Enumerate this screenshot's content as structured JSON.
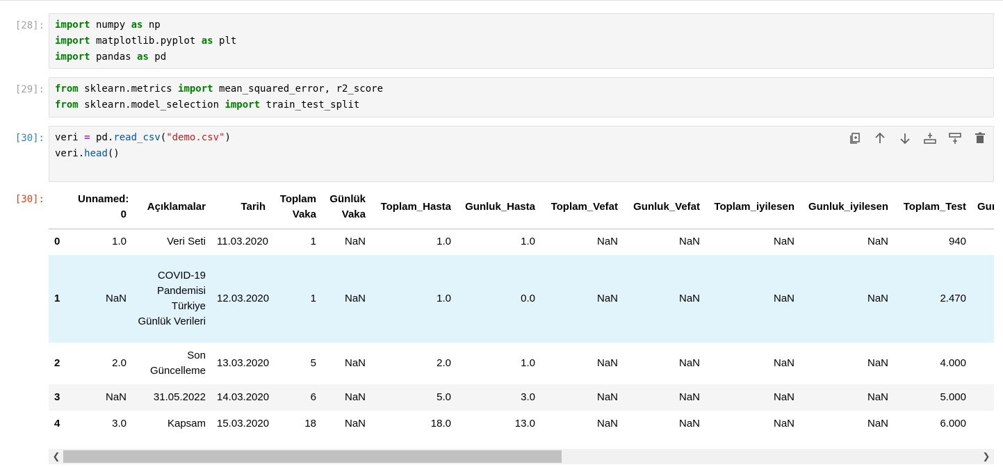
{
  "cells": [
    {
      "prompt": "[28]:",
      "lines": [
        [
          {
            "t": "import",
            "c": "kw"
          },
          {
            "t": " numpy ",
            "c": ""
          },
          {
            "t": "as",
            "c": "kw"
          },
          {
            "t": " np",
            "c": ""
          }
        ],
        [
          {
            "t": "import",
            "c": "kw"
          },
          {
            "t": " matplotlib.pyplot ",
            "c": ""
          },
          {
            "t": "as",
            "c": "kw"
          },
          {
            "t": " plt",
            "c": ""
          }
        ],
        [
          {
            "t": "import",
            "c": "kw"
          },
          {
            "t": " pandas ",
            "c": ""
          },
          {
            "t": "as",
            "c": "kw"
          },
          {
            "t": " pd",
            "c": ""
          }
        ]
      ]
    },
    {
      "prompt": "[29]:",
      "lines": [
        [
          {
            "t": "from",
            "c": "kw"
          },
          {
            "t": " sklearn.metrics ",
            "c": ""
          },
          {
            "t": "import",
            "c": "kw"
          },
          {
            "t": " mean_squared_error, r2_score",
            "c": ""
          }
        ],
        [
          {
            "t": "from",
            "c": "kw"
          },
          {
            "t": " sklearn.model_selection ",
            "c": ""
          },
          {
            "t": "import",
            "c": "kw"
          },
          {
            "t": " train_test_split",
            "c": ""
          }
        ]
      ]
    },
    {
      "prompt": "[30]:",
      "lines": [
        [
          {
            "t": "veri ",
            "c": ""
          },
          {
            "t": "=",
            "c": "op"
          },
          {
            "t": " pd.",
            "c": ""
          },
          {
            "t": "read_csv",
            "c": "fn"
          },
          {
            "t": "(",
            "c": ""
          },
          {
            "t": "\"demo.csv\"",
            "c": "str"
          },
          {
            "t": ")",
            "c": ""
          }
        ],
        [
          {
            "t": "veri.",
            "c": ""
          },
          {
            "t": "head",
            "c": "fn"
          },
          {
            "t": "()",
            "c": ""
          }
        ]
      ]
    }
  ],
  "toolbar": {
    "icons": [
      "duplicate-cell-icon",
      "move-up-icon",
      "move-down-icon",
      "insert-above-icon",
      "insert-below-icon",
      "delete-cell-icon"
    ]
  },
  "output": {
    "prompt": "[30]:",
    "columns": [
      "",
      "Unnamed: 0",
      "Açıklamalar",
      "Tarih",
      "Toplam Vaka",
      "Günlük Vaka",
      "Toplam_Hasta",
      "Gunluk_Hasta",
      "Toplam_Vefat",
      "Gunluk_Vefat",
      "Toplam_iyilesen",
      "Gunluk_iyilesen",
      "Toplam_Test",
      "Gunluk_Test"
    ],
    "rows": [
      [
        "0",
        "1.0",
        "Veri Seti",
        "11.03.2020",
        "1",
        "NaN",
        "1.0",
        "1.0",
        "NaN",
        "NaN",
        "NaN",
        "NaN",
        "940",
        ""
      ],
      [
        "1",
        "NaN",
        "COVID-19 Pandemisi Türkiye Günlük Verileri",
        "12.03.2020",
        "1",
        "NaN",
        "1.0",
        "0.0",
        "NaN",
        "NaN",
        "NaN",
        "NaN",
        "2.470",
        ""
      ],
      [
        "2",
        "2.0",
        "Son Güncelleme",
        "13.03.2020",
        "5",
        "NaN",
        "2.0",
        "1.0",
        "NaN",
        "NaN",
        "NaN",
        "NaN",
        "4.000",
        ""
      ],
      [
        "3",
        "NaN",
        "31.05.2022",
        "14.03.2020",
        "6",
        "NaN",
        "5.0",
        "3.0",
        "NaN",
        "NaN",
        "NaN",
        "NaN",
        "5.000",
        ""
      ],
      [
        "4",
        "3.0",
        "Kapsam",
        "15.03.2020",
        "18",
        "NaN",
        "18.0",
        "13.0",
        "NaN",
        "NaN",
        "NaN",
        "NaN",
        "6.000",
        ""
      ]
    ],
    "row_styles": [
      "plain",
      "highlight",
      "plain",
      "striped",
      "plain"
    ]
  },
  "scrollbar": {
    "left_arrow": "❮",
    "right_arrow": "❯"
  }
}
